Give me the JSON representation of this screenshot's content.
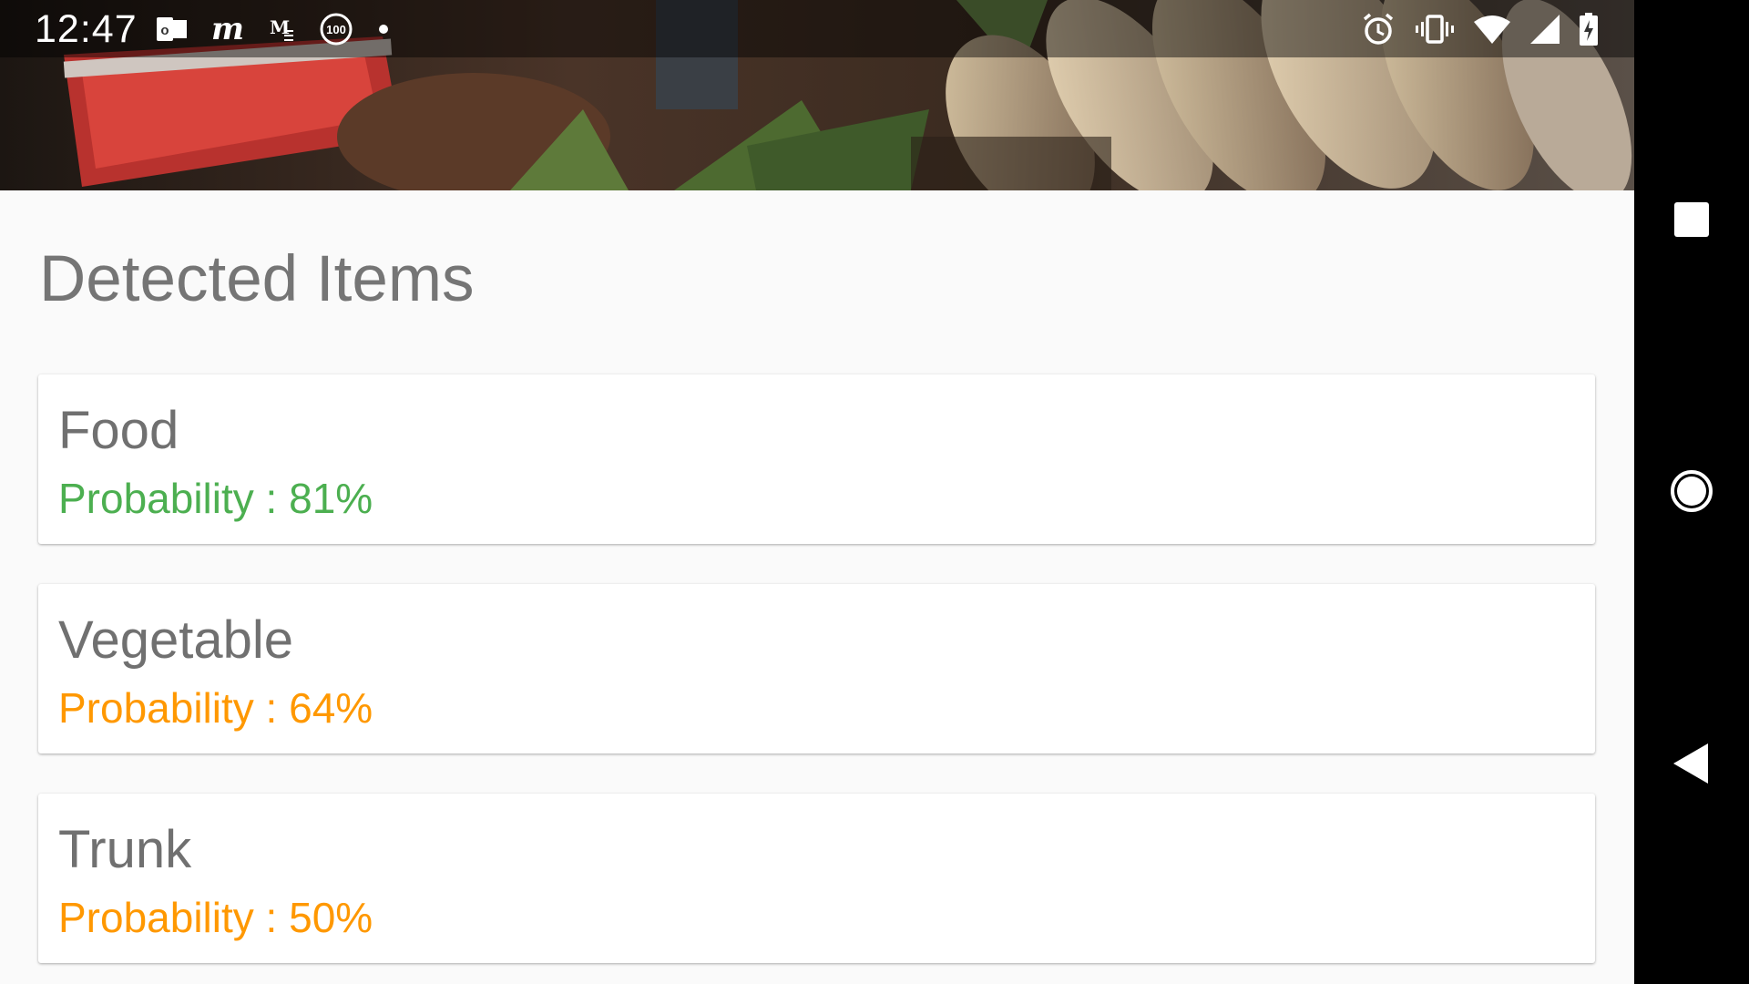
{
  "status_bar": {
    "time": "12:47",
    "left_icons": [
      "outlook-icon",
      "m-app-icon",
      "gmail-icon",
      "badge-100-icon",
      "dot-icon"
    ],
    "badge_text": "100",
    "right_icons": [
      "alarm-icon",
      "vibrate-icon",
      "wifi-icon",
      "cell-signal-icon",
      "battery-charging-icon"
    ]
  },
  "camera_preview": {
    "description_icon": "camera-preview-image"
  },
  "main": {
    "title": "Detected Items",
    "items": [
      {
        "label": "Food",
        "probability_text": "Probability : 81%",
        "probability": 0.81,
        "color": "#4caf50"
      },
      {
        "label": "Vegetable",
        "probability_text": "Probability : 64%",
        "probability": 0.64,
        "color": "#ff9800"
      },
      {
        "label": "Trunk",
        "probability_text": "Probability : 50%",
        "probability": 0.5,
        "color": "#ff9800"
      }
    ]
  },
  "nav_bar": {
    "buttons": [
      "recents-button",
      "home-button",
      "back-button"
    ]
  },
  "colors": {
    "high_confidence": "#4caf50",
    "medium_confidence": "#ff9800",
    "title_text": "#757575",
    "background": "#fafafa"
  }
}
